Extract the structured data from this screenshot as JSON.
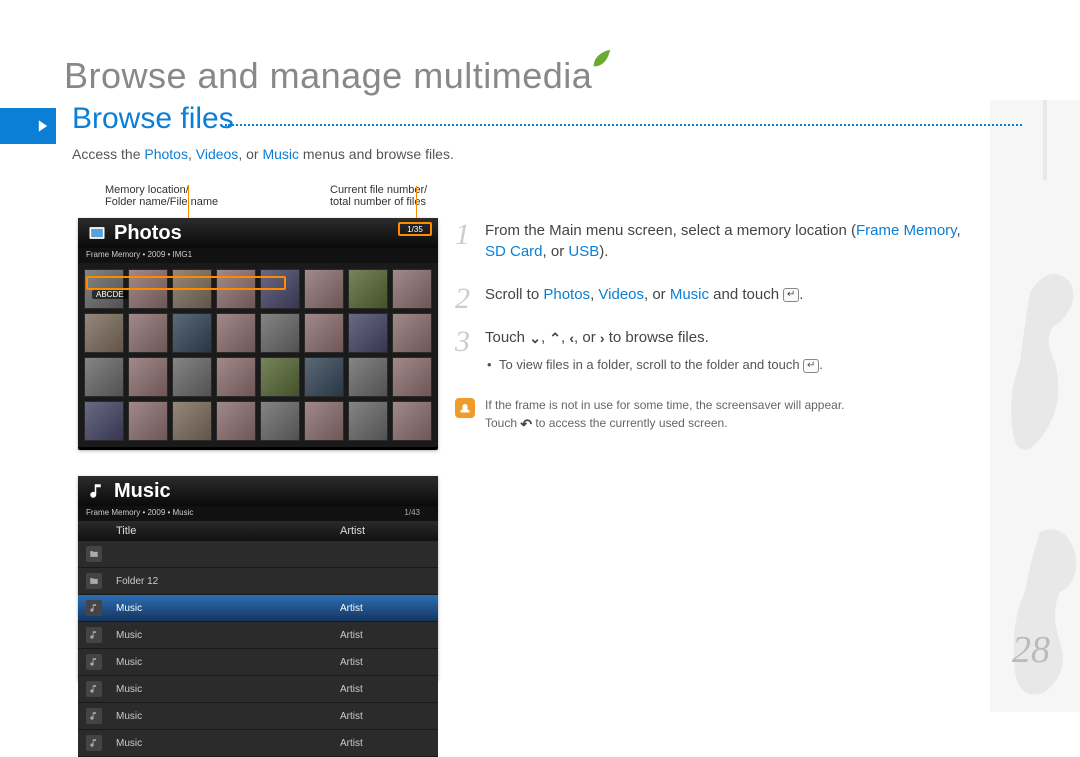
{
  "page_title": "Browse and manage multimedia",
  "section_heading": "Browse files",
  "intro": {
    "prefix": "Access the ",
    "k1": "Photos",
    "sep1": ", ",
    "k2": "Videos",
    "sep2": ", or ",
    "k3": "Music",
    "suffix": " menus and browse files."
  },
  "callouts": {
    "a_line1": "Memory location/",
    "a_line2": "Folder name/File name",
    "b_line1": "Current file number/",
    "b_line2": "total number of files"
  },
  "photos_screen": {
    "title": "Photos",
    "crumb": "Frame Memory • 2009 • IMG1",
    "count_label": "1/35",
    "sel_label": "ABCDE"
  },
  "music_screen": {
    "title": "Music",
    "crumb": "Frame Memory • 2009 • Music",
    "count": "1/43",
    "col_title": "Title",
    "col_artist": "Artist",
    "rows": [
      {
        "title": "",
        "artist": ""
      },
      {
        "title": "Folder 12",
        "artist": ""
      },
      {
        "title": "Music",
        "artist": "Artist",
        "selected": true
      },
      {
        "title": "Music",
        "artist": "Artist"
      },
      {
        "title": "Music",
        "artist": "Artist"
      },
      {
        "title": "Music",
        "artist": "Artist"
      },
      {
        "title": "Music",
        "artist": "Artist"
      },
      {
        "title": "Music",
        "artist": "Artist"
      }
    ]
  },
  "steps": {
    "s1a": "From the Main menu screen, select a memory location (",
    "s1k1": "Frame Memory",
    "s1sep1": ", ",
    "s1k2": "SD Card",
    "s1sep2": ", or ",
    "s1k3": "USB",
    "s1b": ").",
    "s2a": "Scroll to ",
    "s2k1": "Photos",
    "s2sep1": ", ",
    "s2k2": "Videos",
    "s2sep2": ", or ",
    "s2k3": "Music",
    "s2b": " and touch ",
    "s2c": ".",
    "s3a": "Touch ",
    "s3b": ", ",
    "s3c": ", ",
    "s3d": ", or ",
    "s3e": " to browse files.",
    "s3_sub_a": "To view files in a folder, scroll to the folder and touch ",
    "s3_sub_b": ".",
    "note_a": "If the frame is not in use for some time, the screensaver will appear.",
    "note_b1": "Touch ",
    "note_b2": " to access the currently used screen."
  },
  "icons": {
    "enter": "↵",
    "down": "⌄",
    "up": "⌃",
    "left": "‹",
    "right": "›",
    "back": "↶"
  },
  "page_number": "28"
}
